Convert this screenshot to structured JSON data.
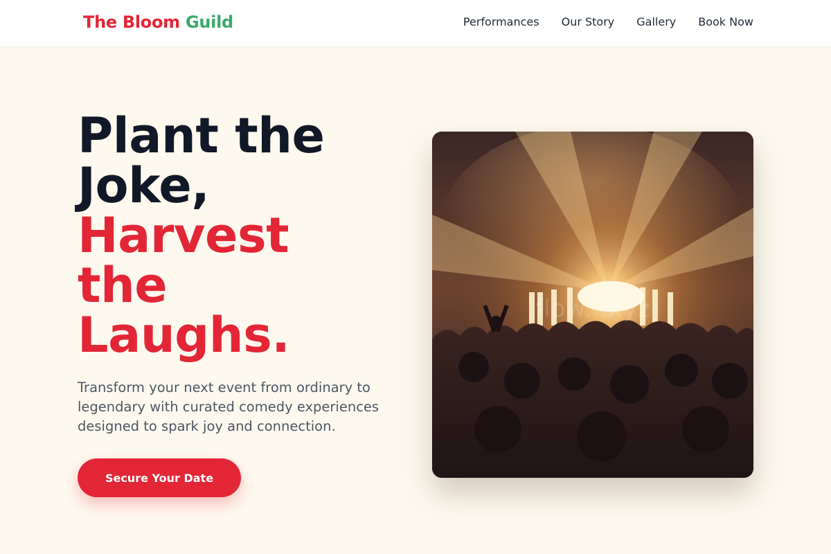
{
  "header": {
    "logo": {
      "part1": "The Bloom",
      "part2": "Guild"
    },
    "nav": [
      "Performances",
      "Our Story",
      "Gallery",
      "Book Now"
    ]
  },
  "hero": {
    "headline_dark": [
      "Plant the",
      "Joke,"
    ],
    "headline_red": [
      "Harvest",
      "the",
      "Laughs."
    ],
    "subtext": "Transform your next event from ordinary to legendary with curated comedy experiences designed to spark joy and connection.",
    "cta_label": "Secure Your Date",
    "image_watermark": "flow...xyz"
  },
  "colors": {
    "accent_red": "#e32636",
    "accent_green": "#3aa86b",
    "page_background": "#fef9ef",
    "headline_dark": "#111827"
  }
}
